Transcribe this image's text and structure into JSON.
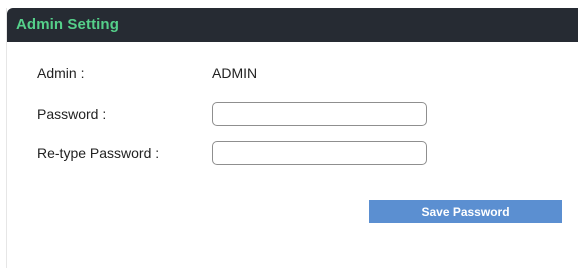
{
  "panel": {
    "title": "Admin Setting"
  },
  "form": {
    "admin_label": "Admin :",
    "admin_value": "ADMIN",
    "password_label": "Password :",
    "password_value": "",
    "retype_label": "Re-type Password :",
    "retype_value": ""
  },
  "actions": {
    "save_label": "Save Password"
  },
  "colors": {
    "header_bg": "#262b33",
    "title_text": "#55d08a",
    "button_bg": "#5b8fd1"
  }
}
